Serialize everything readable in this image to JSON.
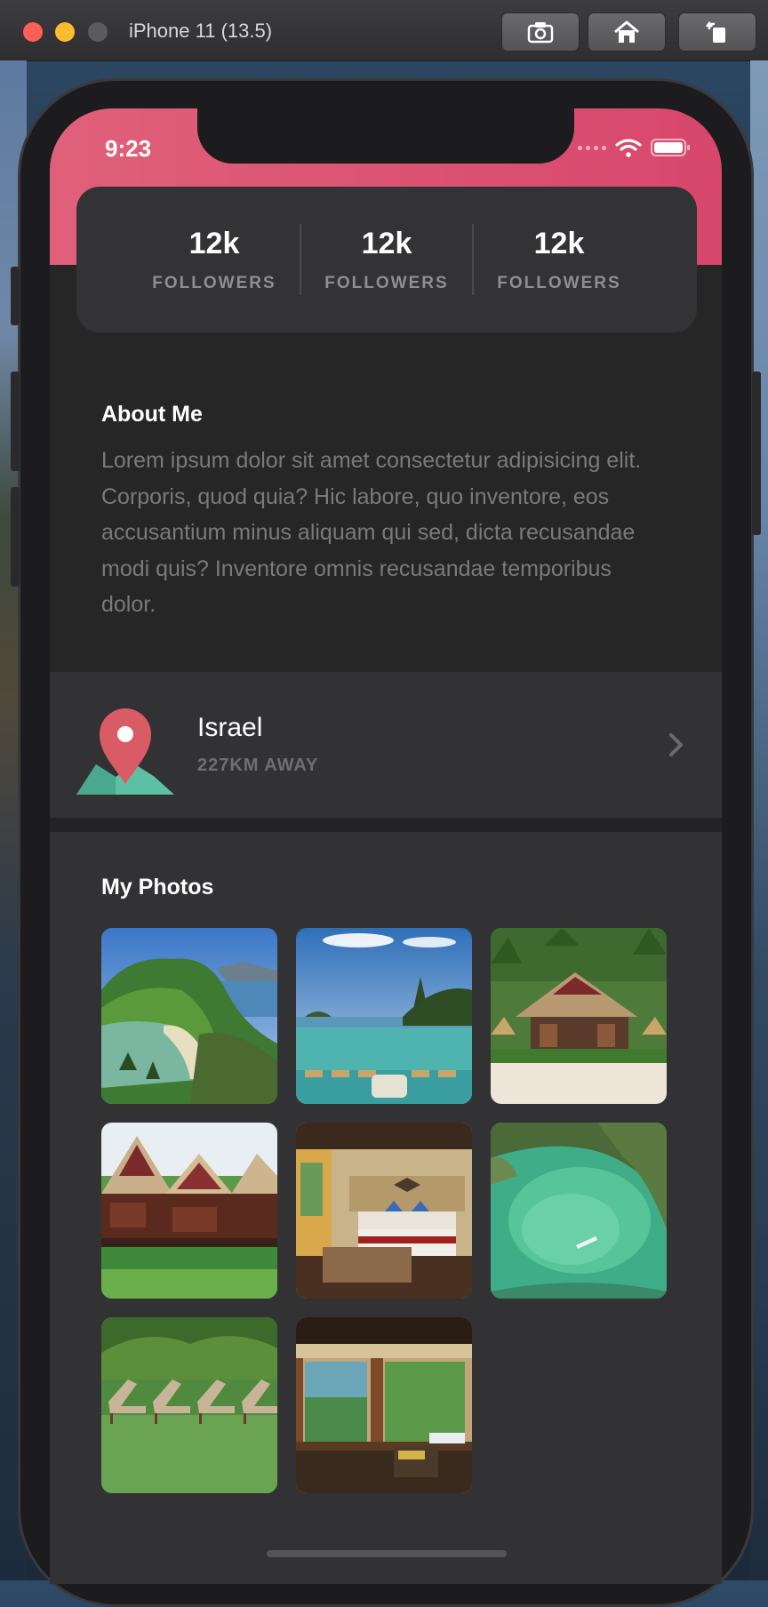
{
  "simulator": {
    "title": "iPhone 11 (13.5)",
    "buttons": [
      "screenshot-icon",
      "home-icon",
      "rotate-icon"
    ]
  },
  "status_bar": {
    "time": "9:23"
  },
  "stats": [
    {
      "value": "12k",
      "label": "FOLLOWERS"
    },
    {
      "value": "12k",
      "label": "FOLLOWERS"
    },
    {
      "value": "12k",
      "label": "FOLLOWERS"
    }
  ],
  "about": {
    "title": "About Me",
    "text": "Lorem ipsum dolor sit amet consectetur adipisicing elit. Corporis, quod quia? Hic labore, quo inventore, eos accusantium minus aliquam qui sed, dicta recusandae modi quis? Inventore omnis recusandae temporibus dolor."
  },
  "location": {
    "name": "Israel",
    "distance": "227KM AWAY"
  },
  "photos": {
    "title": "My Photos",
    "items": [
      {
        "name": "island-lagoon"
      },
      {
        "name": "infinity-pool"
      },
      {
        "name": "beach-hut"
      },
      {
        "name": "stilt-villas"
      },
      {
        "name": "hotel-bedroom"
      },
      {
        "name": "green-lagoon-boat"
      },
      {
        "name": "lounge-chairs"
      },
      {
        "name": "villa-terrace"
      }
    ]
  },
  "colors": {
    "accent": "#dd5274",
    "background": "#262626",
    "card": "#333335"
  }
}
